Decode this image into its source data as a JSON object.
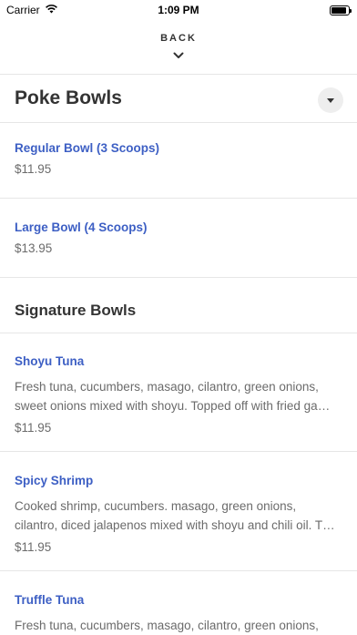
{
  "status_bar": {
    "carrier": "Carrier",
    "time": "1:09 PM"
  },
  "nav": {
    "back_label": "BACK"
  },
  "sections": {
    "poke": {
      "title": "Poke Bowls",
      "items": [
        {
          "name": "Regular Bowl (3 Scoops)",
          "price": "$11.95"
        },
        {
          "name": "Large Bowl (4 Scoops)",
          "price": "$13.95"
        }
      ]
    },
    "signature": {
      "title": "Signature Bowls",
      "items": [
        {
          "name": "Shoyu Tuna",
          "desc_line1": "Fresh tuna, cucumbers, masago, cilantro, green onions,",
          "desc_line2": "sweet onions mixed with shoyu. Topped off with fried ga…",
          "price": "$11.95"
        },
        {
          "name": "Spicy Shrimp",
          "desc_line1": "Cooked shrimp, cucumbers. masago, green onions,",
          "desc_line2": "cilantro, diced jalapenos mixed with shoyu and chili oil. T…",
          "price": "$11.95"
        },
        {
          "name": "Truffle Tuna",
          "desc_line1": "Fresh tuna, cucumbers, masago, cilantro, green onions,"
        }
      ]
    }
  },
  "colors": {
    "accent_link": "#3d5fc4",
    "text_primary": "#333333",
    "text_secondary": "#6b6b6b",
    "divider": "#e6e6e6"
  },
  "icons": {
    "wifi": "wifi-icon",
    "battery": "battery-icon",
    "back_chevron": "chevron-down-icon",
    "dropdown": "caret-down-icon"
  }
}
